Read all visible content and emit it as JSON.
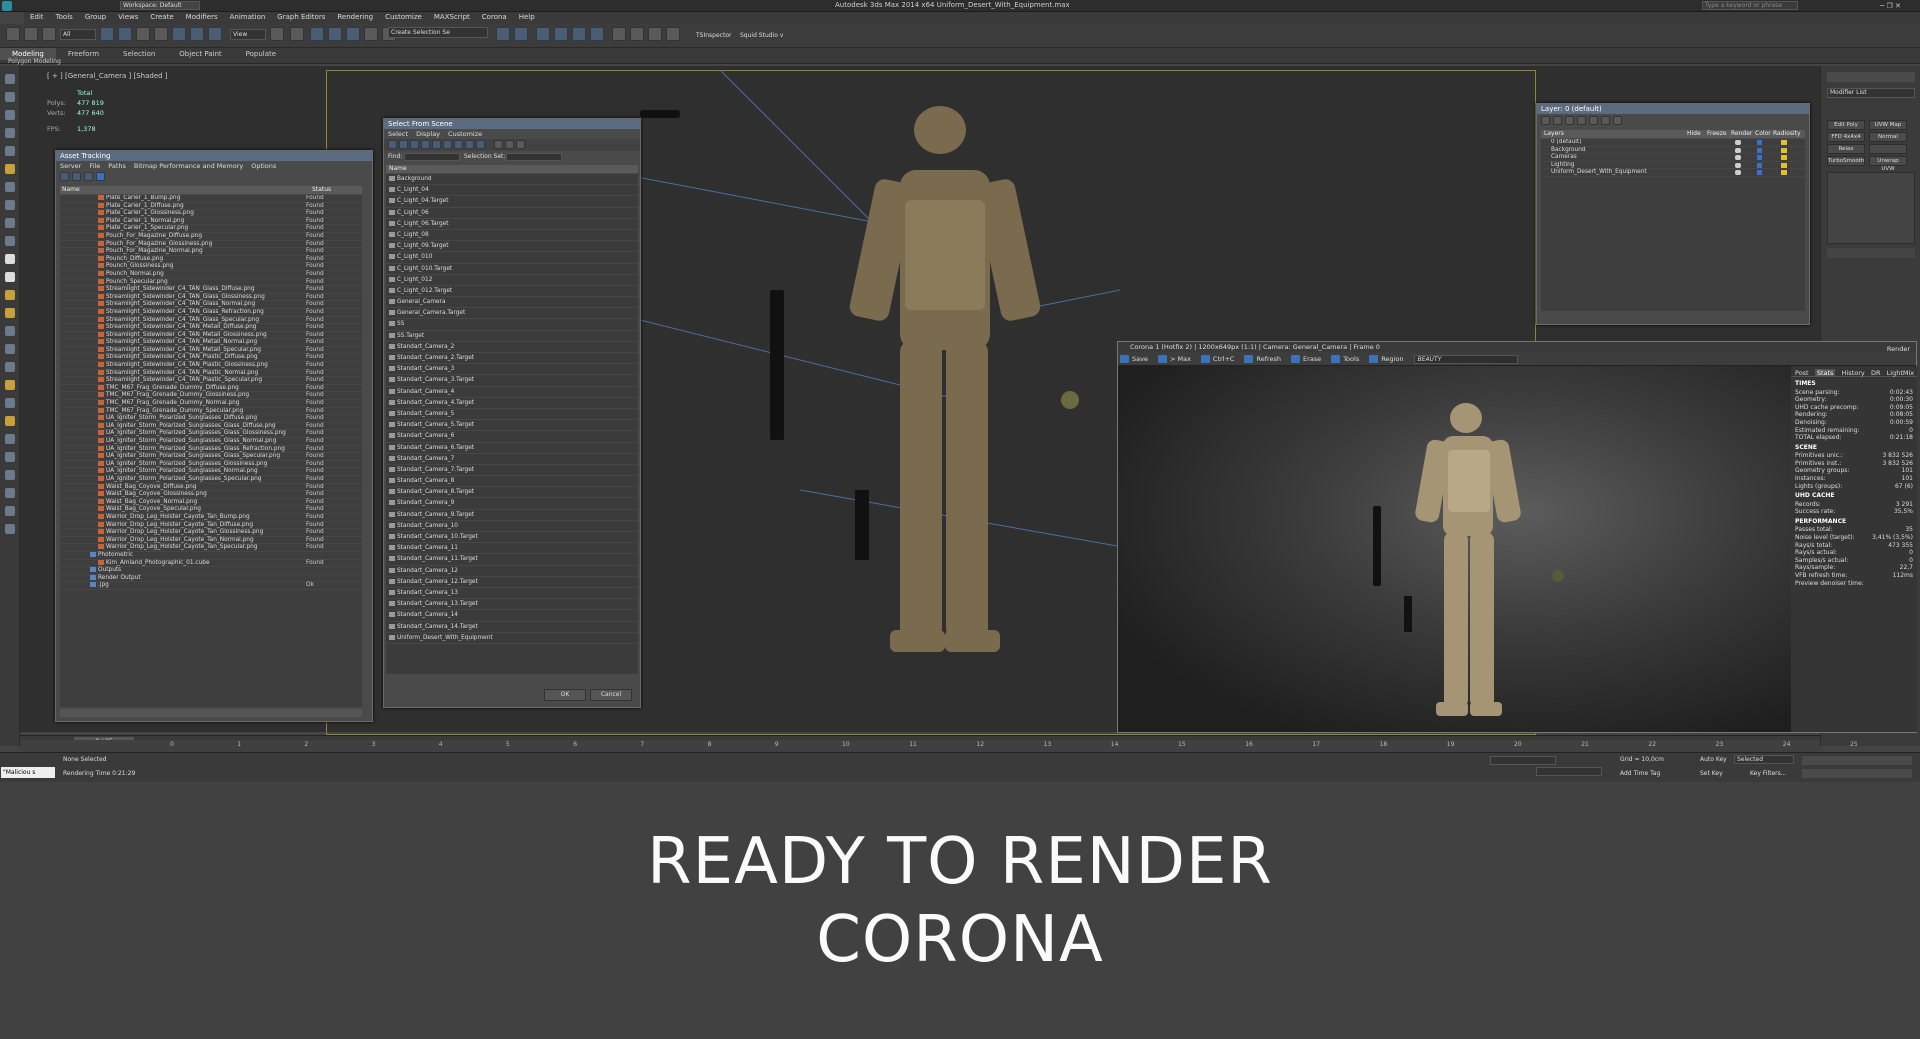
{
  "window": {
    "title": "Autodesk 3ds Max 2014 x64     Uniform_Desert_With_Equipment.max",
    "search_placeholder": "Type a keyword or phrase",
    "workspace": "Workspace: Default"
  },
  "menu": [
    "Edit",
    "Tools",
    "Group",
    "Views",
    "Create",
    "Modifiers",
    "Animation",
    "Graph Editors",
    "Rendering",
    "Customize",
    "MAXScript",
    "Corona",
    "Help"
  ],
  "toolbar": {
    "view_dropdown": "View",
    "selection_set": "Create Selection Se",
    "plugin1": "TSInspector",
    "plugin2": "Squid Studio v"
  },
  "ribbon": {
    "tabs": [
      "Modeling",
      "Freeform",
      "Selection",
      "Object Paint",
      "Populate"
    ],
    "active": "Modeling",
    "sub": "Polygon Modeling"
  },
  "viewport": {
    "label": "[ + ] [General_Camera ] [Shaded ]",
    "stats": {
      "header": "Total",
      "polys_label": "Polys:",
      "polys": "477 819",
      "verts_label": "Verts:",
      "verts": "477 640",
      "fps_label": "FPS:",
      "fps": "1,378"
    }
  },
  "asset_tracking": {
    "title": "Asset Tracking",
    "menu": [
      "Server",
      "File",
      "Paths",
      "Bitmap Performance and Memory",
      "Options"
    ],
    "col_name": "Name",
    "col_status": "Status",
    "rows": [
      [
        "Plate_Carier_1_Bump.png",
        "Found"
      ],
      [
        "Plate_Carier_1_Diffuse.png",
        "Found"
      ],
      [
        "Plate_Carier_1_Glossiness.png",
        "Found"
      ],
      [
        "Plate_Carier_1_Normal.png",
        "Found"
      ],
      [
        "Plate_Carier_1_Specular.png",
        "Found"
      ],
      [
        "Pouch_For_Magazine_Diffuse.png",
        "Found"
      ],
      [
        "Pouch_For_Magazine_Glossiness.png",
        "Found"
      ],
      [
        "Pouch_For_Magazine_Normal.png",
        "Found"
      ],
      [
        "Pounch_Diffuse.png",
        "Found"
      ],
      [
        "Pounch_Glossiness.png",
        "Found"
      ],
      [
        "Pounch_Normal.png",
        "Found"
      ],
      [
        "Pounch_Specular.png",
        "Found"
      ],
      [
        "Streamlight_Sidewinder_C4_TAN_Glass_Diffuse.png",
        "Found"
      ],
      [
        "Streamlight_Sidewinder_C4_TAN_Glass_Glossiness.png",
        "Found"
      ],
      [
        "Streamlight_Sidewinder_C4_TAN_Glass_Normal.png",
        "Found"
      ],
      [
        "Streamlight_Sidewinder_C4_TAN_Glass_Refraction.png",
        "Found"
      ],
      [
        "Streamlight_Sidewinder_C4_TAN_Glass_Specular.png",
        "Found"
      ],
      [
        "Streamlight_Sidewinder_C4_TAN_Metall_Diffuse.png",
        "Found"
      ],
      [
        "Streamlight_Sidewinder_C4_TAN_Metall_Glossiness.png",
        "Found"
      ],
      [
        "Streamlight_Sidewinder_C4_TAN_Metall_Normal.png",
        "Found"
      ],
      [
        "Streamlight_Sidewinder_C4_TAN_Metall_Specular.png",
        "Found"
      ],
      [
        "Streamlight_Sidewinder_C4_TAN_Plastic_Diffuse.png",
        "Found"
      ],
      [
        "Streamlight_Sidewinder_C4_TAN_Plastic_Glossiness.png",
        "Found"
      ],
      [
        "Streamlight_Sidewinder_C4_TAN_Plastic_Normal.png",
        "Found"
      ],
      [
        "Streamlight_Sidewinder_C4_TAN_Plastic_Specular.png",
        "Found"
      ],
      [
        "TMC_M67_Frag_Grenade_Dummy_Diffuse.png",
        "Found"
      ],
      [
        "TMC_M67_Frag_Grenade_Dummy_Glossiness.png",
        "Found"
      ],
      [
        "TMC_M67_Frag_Grenade_Dummy_Normal.png",
        "Found"
      ],
      [
        "TMC_M67_Frag_Grenade_Dummy_Specular.png",
        "Found"
      ],
      [
        "UA_Igniter_Storm_Polarized_Sunglasses_Diffuse.png",
        "Found"
      ],
      [
        "UA_Igniter_Storm_Polarized_Sunglasses_Glass_Diffuse.png",
        "Found"
      ],
      [
        "UA_Igniter_Storm_Polarized_Sunglasses_Glass_Glossiness.png",
        "Found"
      ],
      [
        "UA_Igniter_Storm_Polarized_Sunglasses_Glass_Normal.png",
        "Found"
      ],
      [
        "UA_Igniter_Storm_Polarized_Sunglasses_Glass_Refraction.png",
        "Found"
      ],
      [
        "UA_Igniter_Storm_Polarized_Sunglasses_Glass_Specular.png",
        "Found"
      ],
      [
        "UA_Igniter_Storm_Polarized_Sunglasses_Glossiness.png",
        "Found"
      ],
      [
        "UA_Igniter_Storm_Polarized_Sunglasses_Normal.png",
        "Found"
      ],
      [
        "UA_Igniter_Storm_Polarized_Sunglasses_Specular.png",
        "Found"
      ],
      [
        "Waist_Bag_Coyove_Diffuse.png",
        "Found"
      ],
      [
        "Waist_Bag_Coyove_Glossiness.png",
        "Found"
      ],
      [
        "Waist_Bag_Coyove_Normal.png",
        "Found"
      ],
      [
        "Waist_Bag_Coyove_Specular.png",
        "Found"
      ],
      [
        "Warrior_Drop_Leg_Holster_Cayote_Tan_Bump.png",
        "Found"
      ],
      [
        "Warrior_Drop_Leg_Holster_Cayote_Tan_Diffuse.png",
        "Found"
      ],
      [
        "Warrior_Drop_Leg_Holster_Cayote_Tan_Glossiness.png",
        "Found"
      ],
      [
        "Warrior_Drop_Leg_Holster_Cayote_Tan_Normal.png",
        "Found"
      ],
      [
        "Warrior_Drop_Leg_Holster_Cayote_Tan_Specular.png",
        "Found"
      ],
      [
        "Photometric",
        ""
      ],
      [
        "Kim_Amland_Photographic_01.cube",
        "Found"
      ],
      [
        "Outputs",
        ""
      ],
      [
        "Render Output",
        ""
      ],
      [
        ".jpg",
        "Ok"
      ]
    ]
  },
  "select_from_scene": {
    "title": "Select From Scene",
    "menu": [
      "Select",
      "Display",
      "Customize"
    ],
    "find_label": "Find:",
    "selset_label": "Selection Set:",
    "col_name": "Name",
    "items": [
      "Background",
      "C_Light_04",
      "C_Light_04.Target",
      "C_Light_06",
      "C_Light_06.Target",
      "C_Light_08",
      "C_Light_09.Target",
      "C_Light_010",
      "C_Light_010.Target",
      "C_Light_012",
      "C_Light_012.Target",
      "General_Camera",
      "General_Camera.Target",
      "SS",
      "SS.Target",
      "Standart_Camera_2",
      "Standart_Camera_2.Target",
      "Standart_Camera_3",
      "Standart_Camera_3.Target",
      "Standart_Camera_4",
      "Standart_Camera_4.Target",
      "Standart_Camera_5",
      "Standart_Camera_5.Target",
      "Standart_Camera_6",
      "Standart_Camera_6.Target",
      "Standart_Camera_7",
      "Standart_Camera_7.Target",
      "Standart_Camera_8",
      "Standart_Camera_8.Target",
      "Standart_Camera_9",
      "Standart_Camera_9.Target",
      "Standart_Camera_10",
      "Standart_Camera_10.Target",
      "Standart_Camera_11",
      "Standart_Camera_11.Target",
      "Standart_Camera_12",
      "Standart_Camera_12.Target",
      "Standart_Camera_13",
      "Standart_Camera_13.Target",
      "Standart_Camera_14",
      "Standart_Camera_14.Target",
      "Uniform_Desert_With_Equipment"
    ],
    "ok": "OK",
    "cancel": "Cancel"
  },
  "layer_panel": {
    "title": "Layer: 0 (default)",
    "columns": [
      "Layers",
      "Hide",
      "Freeze",
      "Render",
      "Color",
      "Radiosity"
    ],
    "layers": [
      "0 (default)",
      "Background",
      "Cameras",
      "Lighting",
      "Uniform_Desert_With_Equipment"
    ]
  },
  "modify_panel": {
    "list_label": "Modifier List",
    "buttons": [
      "Edit Poly",
      "UVW Map",
      "FFD 4x4x4",
      "Normal",
      "Relax",
      "",
      "TurboSmooth",
      "Unwrap UVW"
    ]
  },
  "corona_vfb": {
    "title": "Corona 1 (Hotfix 2) | 1200x649px (1:1) | Camera: General_Camera | Frame 0",
    "toolbar": [
      "Save",
      "> Max",
      "Ctrl+C",
      "Refresh",
      "Erase",
      "Tools",
      "Region"
    ],
    "channel": "BEAUTY",
    "render_btn": "Render",
    "tabs": [
      "Post",
      "Stats",
      "History",
      "DR",
      "LightMix"
    ],
    "active_tab": "Stats",
    "sections": [
      {
        "title": "TIMES",
        "rows": [
          [
            "Scene parsing:",
            "0:02:43"
          ],
          [
            "Geometry:",
            "0:00:30"
          ],
          [
            "UHD cache precomp:",
            "0:09:05"
          ],
          [
            "Rendering:",
            "0:08:05"
          ],
          [
            "Denoising:",
            "0:00:59"
          ],
          [
            "Estimated remaining:",
            "0"
          ],
          [
            "TOTAL elapsed:",
            "0:21:18"
          ]
        ]
      },
      {
        "title": "SCENE",
        "rows": [
          [
            "Primitives unic.:",
            "3 832 526"
          ],
          [
            "Primitives inst.:",
            "3 832 526"
          ],
          [
            "Geometry groups:",
            "101"
          ],
          [
            "Instances:",
            "101"
          ],
          [
            "Lights (groups):",
            "67 (6)"
          ]
        ]
      },
      {
        "title": "UHD CACHE",
        "rows": [
          [
            "Records:",
            "3 291"
          ],
          [
            "Success rate:",
            "35,5%"
          ]
        ]
      },
      {
        "title": "PERFORMANCE",
        "rows": [
          [
            "Passes total:",
            "35"
          ],
          [
            "Noise level (target):",
            "3,41% (3,5%)"
          ],
          [
            "Rays/s total:",
            "473 355"
          ],
          [
            "Rays/s actual:",
            "0"
          ],
          [
            "Samples/s actual:",
            "0"
          ],
          [
            "Rays/sample:",
            "22,7"
          ],
          [
            "VFB refresh time:",
            "112ms"
          ],
          [
            "Preview denoiser time:",
            ""
          ]
        ]
      }
    ]
  },
  "timeline": {
    "frame": "0 / 25",
    "ticks": [
      "0",
      "1",
      "2",
      "3",
      "4",
      "5",
      "6",
      "7",
      "8",
      "9",
      "10",
      "11",
      "12",
      "13",
      "14",
      "15",
      "16",
      "17",
      "18",
      "19",
      "20",
      "21",
      "22",
      "23",
      "24",
      "25"
    ]
  },
  "status": {
    "script_box": "\"Maliciou s",
    "selection": "None Selected",
    "render_time": "Rendering Time  0:21:29",
    "grid": "Grid = 10,0cm",
    "add_time_tag": "Add Time Tag",
    "auto_key": "Auto Key",
    "set_key": "Set Key",
    "selected": "Selected",
    "key_filters": "Key Filters..."
  },
  "caption": {
    "line1": "READY TO RENDER",
    "line2": "CORONA"
  }
}
